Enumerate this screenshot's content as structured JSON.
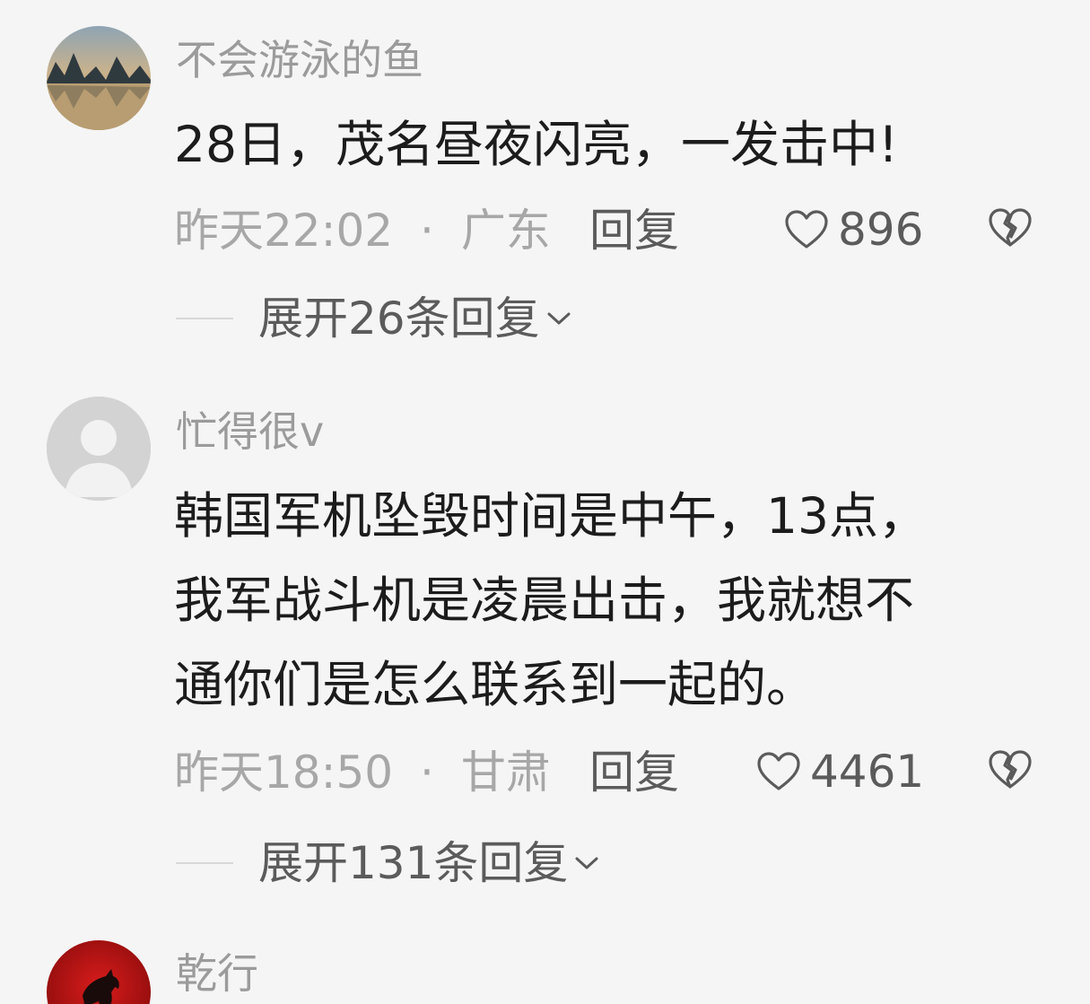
{
  "comments": [
    {
      "username": "不会游泳的鱼",
      "text_lines": [
        "28日，茂名昼夜闪亮，一发击中!"
      ],
      "time": "昨天22:02",
      "separator": "·",
      "location": "广东",
      "reply_label": "回复",
      "likes": "896",
      "expand_label": "展开26条回复",
      "avatar": "landscape-lake"
    },
    {
      "username": "忙得很v",
      "text_lines": [
        "韩国军机坠毁时间是中午，13点，",
        "我军战斗机是凌晨出击，我就想不",
        "通你们是怎么联系到一起的。"
      ],
      "time": "昨天18:50",
      "separator": "·",
      "location": "甘肃",
      "reply_label": "回复",
      "likes": "4461",
      "expand_label": "展开131条回复",
      "avatar": "default-person"
    },
    {
      "username": "乾行",
      "avatar": "red-horse"
    }
  ],
  "icons": {
    "like": "heart-outline-icon",
    "dislike": "broken-heart-icon",
    "expand": "chevron-down-icon"
  },
  "colors": {
    "background": "#f5f5f5",
    "text": "#1c1c1c",
    "muted": "#a7a7a7",
    "action": "#5b5b5b"
  }
}
